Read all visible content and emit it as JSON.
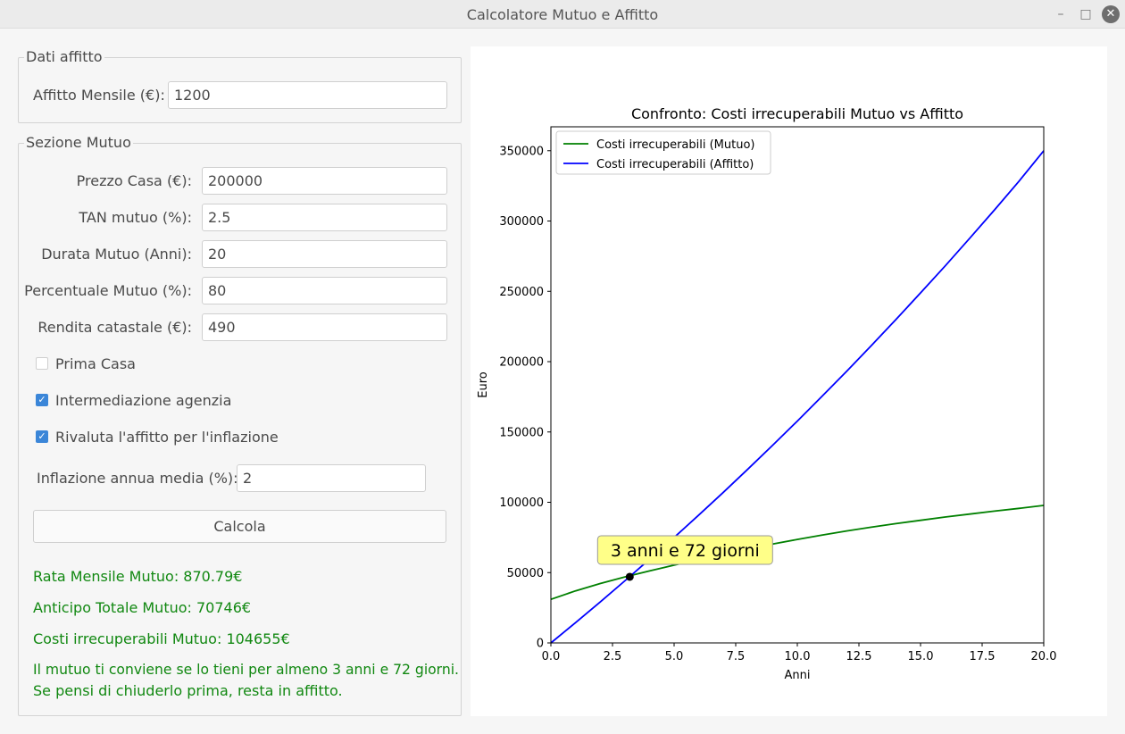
{
  "window": {
    "title": "Calcolatore Mutuo e Affitto"
  },
  "affitto": {
    "group_title": "Dati affitto",
    "monthly_label": "Affitto Mensile (€):",
    "monthly_value": "1200"
  },
  "mutuo": {
    "group_title": "Sezione Mutuo",
    "fields": [
      {
        "label": "Prezzo Casa (€):",
        "value": "200000"
      },
      {
        "label": "TAN mutuo (%):",
        "value": "2.5"
      },
      {
        "label": "Durata Mutuo (Anni):",
        "value": "20"
      },
      {
        "label": "Percentuale Mutuo (%):",
        "value": "80"
      },
      {
        "label": "Rendita catastale (€):",
        "value": "490"
      }
    ],
    "checkboxes": [
      {
        "label": "Prima Casa",
        "checked": false
      },
      {
        "label": "Intermediazione agenzia",
        "checked": true
      },
      {
        "label": "Rivaluta l'affitto per l'inflazione",
        "checked": true
      }
    ],
    "inflation_label": "Inflazione annua media (%):",
    "inflation_value": "2",
    "calc_button": "Calcola"
  },
  "results": {
    "rata": "Rata Mensile Mutuo: 870.79€",
    "anticipo": "Anticipo Totale Mutuo: 70746€",
    "costi": "Costi irrecuperabili Mutuo: 104655€",
    "conclusion_1": "Il mutuo ti conviene se lo tieni per almeno 3 anni e 72 giorni.",
    "conclusion_2": "Se pensi di chiuderlo prima, resta in affitto.",
    "color": "#118811"
  },
  "chart_data": {
    "type": "line",
    "title": "Confronto: Costi irrecuperabili Mutuo vs Affitto",
    "xlabel": "Anni",
    "ylabel": "Euro",
    "xlim": [
      0,
      20
    ],
    "ylim": [
      0,
      367000
    ],
    "xticks": [
      "0.0",
      "2.5",
      "5.0",
      "7.5",
      "10.0",
      "12.5",
      "15.0",
      "17.5",
      "20.0"
    ],
    "yticks": [
      "0",
      "50000",
      "100000",
      "150000",
      "200000",
      "250000",
      "300000",
      "350000"
    ],
    "legend_position": "top-left",
    "series": [
      {
        "name": "Costi irrecuperabili (Mutuo)",
        "color": "#008000",
        "x": [
          0,
          1,
          2,
          3,
          4,
          5,
          6,
          7,
          8,
          9,
          10,
          11,
          12,
          13,
          14,
          15,
          16,
          17,
          18,
          19,
          20
        ],
        "y": [
          31000,
          37000,
          42200,
          46900,
          51200,
          55300,
          59300,
          63100,
          66800,
          70300,
          73600,
          76700,
          79600,
          82300,
          84800,
          87200,
          89500,
          91600,
          93700,
          95700,
          97800
        ]
      },
      {
        "name": "Costi irrecuperabili (Affitto)",
        "color": "#0000ff",
        "x": [
          0,
          1,
          2,
          3,
          4,
          5,
          6,
          7,
          8,
          9,
          10,
          11,
          12,
          13,
          14,
          15,
          16,
          17,
          18,
          19,
          20
        ],
        "y": [
          0,
          14400,
          29100,
          44100,
          59400,
          75000,
          90900,
          107100,
          123700,
          140600,
          157700,
          175300,
          193100,
          211400,
          229900,
          248900,
          268100,
          287800,
          307900,
          328400,
          350000
        ]
      }
    ],
    "crossover": {
      "x": 3.2,
      "y": 47000,
      "annotation": "3 anni e 72 giorni",
      "annotation_bg": "#ffff88"
    }
  }
}
